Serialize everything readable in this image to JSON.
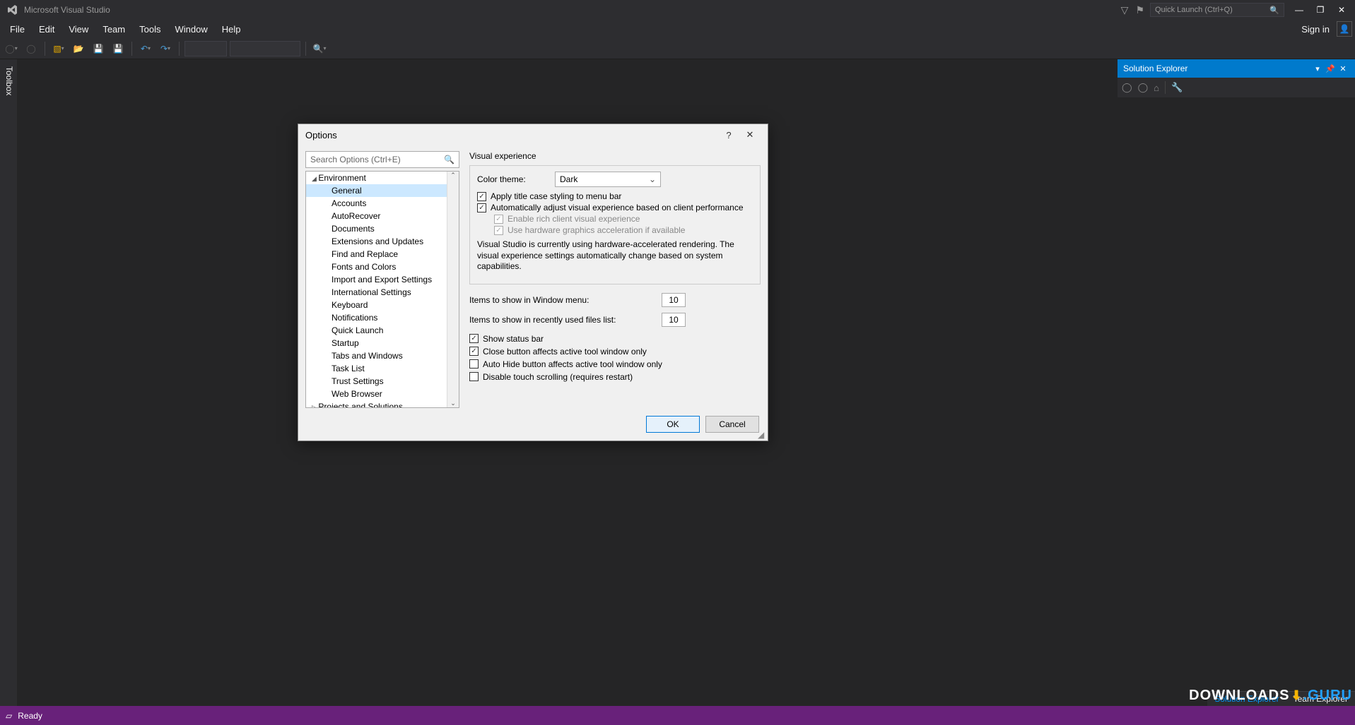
{
  "titlebar": {
    "app_title": "Microsoft Visual Studio",
    "quick_launch_placeholder": "Quick Launch (Ctrl+Q)"
  },
  "menubar": {
    "items": [
      "File",
      "Edit",
      "View",
      "Team",
      "Tools",
      "Window",
      "Help"
    ],
    "sign_in": "Sign in"
  },
  "toolbox": {
    "label": "Toolbox"
  },
  "solution_explorer": {
    "title": "Solution Explorer"
  },
  "bottom_tabs": {
    "active": "Solution Explorer",
    "inactive": "Team Explorer"
  },
  "statusbar": {
    "ready": "Ready"
  },
  "dialog": {
    "title": "Options",
    "search_placeholder": "Search Options (Ctrl+E)",
    "tree": {
      "env": "Environment",
      "items": [
        "General",
        "Accounts",
        "AutoRecover",
        "Documents",
        "Extensions and Updates",
        "Find and Replace",
        "Fonts and Colors",
        "Import and Export Settings",
        "International Settings",
        "Keyboard",
        "Notifications",
        "Quick Launch",
        "Startup",
        "Tabs and Windows",
        "Task List",
        "Trust Settings",
        "Web Browser"
      ],
      "projects": "Projects and Solutions"
    },
    "right": {
      "visual_exp": "Visual experience",
      "color_theme_label": "Color theme:",
      "color_theme_value": "Dark",
      "apply_title_case": "Apply title case styling to menu bar",
      "auto_adjust": "Automatically adjust visual experience based on client performance",
      "enable_rich": "Enable rich client visual experience",
      "use_hw": "Use hardware graphics acceleration if available",
      "info": "Visual Studio is currently using hardware-accelerated rendering. The visual experience settings automatically change based on system capabilities.",
      "items_window_menu": "Items to show in Window menu:",
      "items_window_menu_val": "10",
      "items_recent": "Items to show in recently used files list:",
      "items_recent_val": "10",
      "show_status": "Show status bar",
      "close_affects": "Close button affects active tool window only",
      "autohide_affects": "Auto Hide button affects active tool window only",
      "disable_touch": "Disable touch scrolling (requires restart)"
    },
    "buttons": {
      "ok": "OK",
      "cancel": "Cancel"
    }
  },
  "watermark": {
    "dl": "DOWNLOADS",
    "guru": ".GURU"
  }
}
